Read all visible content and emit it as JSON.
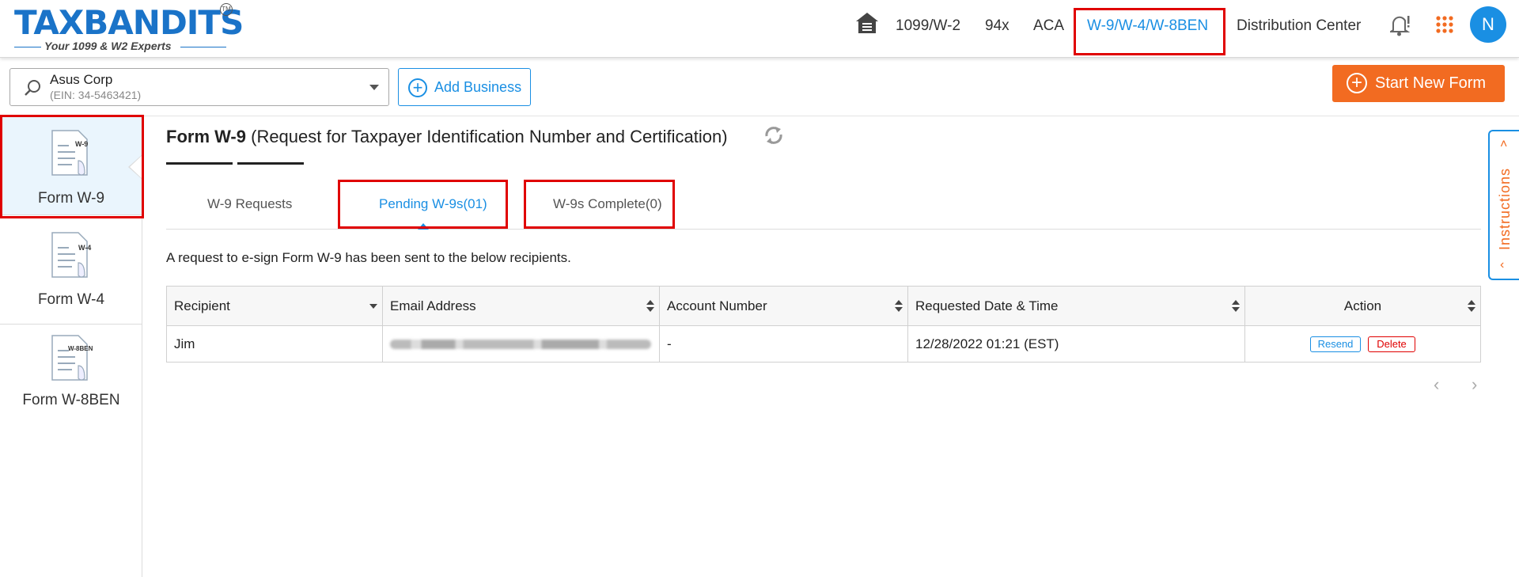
{
  "header": {
    "logo_text": "TAXBANDITS",
    "logo_tm": "TM",
    "logo_tagline": "Your 1099 & W2 Experts",
    "nav": [
      {
        "label": "1099/W-2"
      },
      {
        "label": "94x"
      },
      {
        "label": "ACA"
      },
      {
        "label": "W-9/W-4/W-8BEN",
        "active": true
      },
      {
        "label": "Distribution Center"
      }
    ],
    "avatar_initial": "N"
  },
  "toolbar": {
    "business_name": "Asus Corp",
    "business_ein": "(EIN: 34-5463421)",
    "add_business_label": "Add Business",
    "start_new_form_label": "Start New Form"
  },
  "sidebar": {
    "items": [
      {
        "label": "Form W-9",
        "icon_text": "W-9",
        "active": true
      },
      {
        "label": "Form W-4",
        "icon_text": "W-4"
      },
      {
        "label": "Form W-8BEN",
        "icon_text": "W-8BEN"
      }
    ]
  },
  "main": {
    "title_bold": "Form W-9",
    "title_rest": " (Request for Taxpayer Identification Number and Certification)",
    "tabs": [
      {
        "label": "W-9 Requests"
      },
      {
        "label": "Pending W-9s(01)",
        "active": true
      },
      {
        "label": "W-9s Complete(0)"
      }
    ],
    "info_text": "A request to e-sign Form W-9 has been sent to the below recipients.",
    "table": {
      "columns": [
        "Recipient",
        "Email Address",
        "Account Number",
        "Requested Date & Time",
        "Action"
      ],
      "rows": [
        {
          "recipient": "Jim",
          "email": "",
          "account": "-",
          "requested": "12/28/2022 01:21 (EST)",
          "resend": "Resend",
          "delete": "Delete"
        }
      ]
    },
    "pager_prev": "‹",
    "pager_next": "›"
  },
  "instructions_label": "Instructions",
  "colors": {
    "accent": "#1a8fe3",
    "orange": "#f26b21",
    "highlight": "#e00000"
  }
}
